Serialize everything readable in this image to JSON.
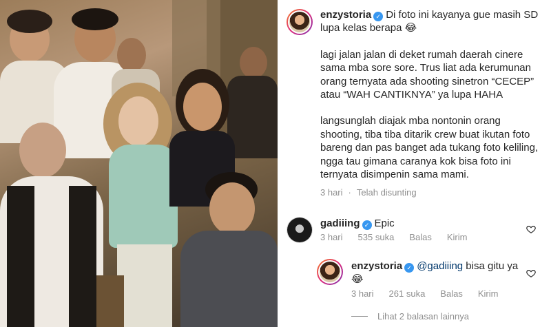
{
  "post": {
    "author": "enzystoria",
    "caption_lines": [
      "Di foto ini kayanya gue masih SD lupa kelas berapa 😂",
      "lagi jalan jalan di deket rumah daerah cinere sama mba sore sore. Trus liat ada kerumunan orang ternyata ada shooting sinetron “CECEP” atau “WAH CANTIKNYA” ya lupa HAHA",
      "langsunglah diajak mba nontonin orang shooting, tiba tiba ditarik crew buat ikutan foto bareng dan pas banget ada tukang foto keliling, ngga tau gimana caranya kok bisa foto ini ternyata disimpenin sama mami."
    ],
    "time": "3 hari",
    "edited": "Telah disunting"
  },
  "comments": [
    {
      "author": "gadiiing",
      "text": "Epic",
      "time": "3 hari",
      "likes": "535 suka",
      "reply": "Balas",
      "send": "Kirim"
    },
    {
      "author": "enzystoria",
      "mention": "@gadiiing",
      "text": " bisa gitu ya😂",
      "time": "3 hari",
      "likes": "261 suka",
      "reply": "Balas",
      "send": "Kirim"
    }
  ],
  "more_replies": "Lihat 2 balasan lainnya",
  "colors": {
    "verified": "#3897f0",
    "mention": "#00376b",
    "meta": "#8e8e8e"
  },
  "icons": [
    "verified-badge-icon",
    "heart-icon"
  ]
}
